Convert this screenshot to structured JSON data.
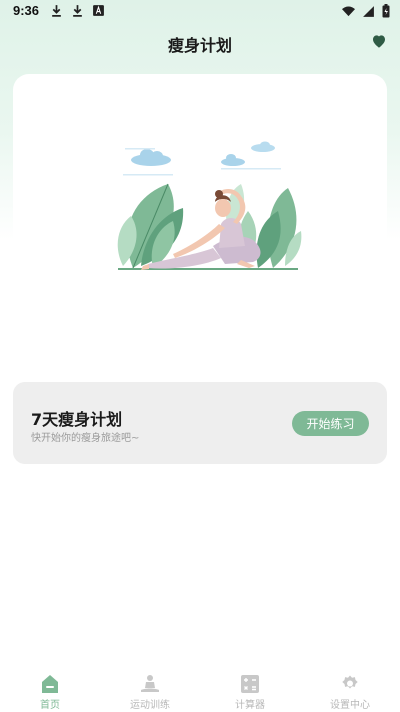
{
  "status_bar": {
    "time": "9:36"
  },
  "header": {
    "title": "瘦身计划",
    "favorite_icon": "heart-icon"
  },
  "hero": {
    "illustration": "yoga-stretch-illustration"
  },
  "plan_card": {
    "title": "7天瘦身计划",
    "subtitle": "快开始你的瘦身旅途吧~",
    "button_label": "开始练习"
  },
  "nav": {
    "items": [
      {
        "label": "首页",
        "icon": "home-icon",
        "active": true
      },
      {
        "label": "运动训练",
        "icon": "meditation-icon",
        "active": false
      },
      {
        "label": "计算器",
        "icon": "calculator-icon",
        "active": false
      },
      {
        "label": "设置中心",
        "icon": "gear-icon",
        "active": false
      }
    ]
  },
  "colors": {
    "accent": "#7fb996",
    "card_bg": "#eeeeee",
    "header_bg": "#dff2e8",
    "heart": "#2f5b45"
  }
}
